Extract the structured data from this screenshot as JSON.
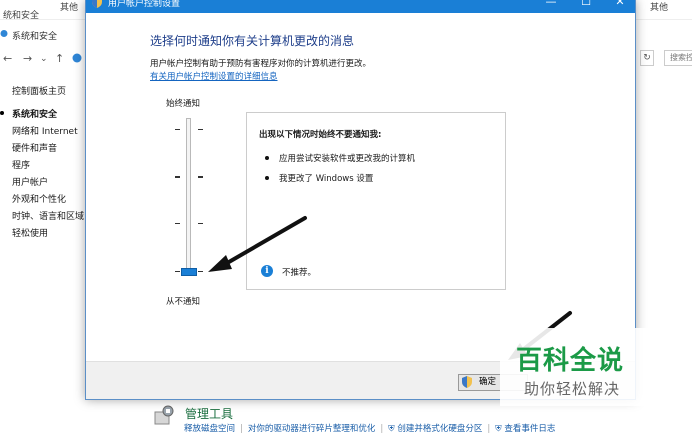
{
  "background": {
    "window_title": "统和安全",
    "tab_left": "其他",
    "tab_right": "其他",
    "address_text": "系统和安全",
    "nav": {
      "back": "←",
      "forward": "→",
      "up": "↑"
    },
    "refresh": "↻",
    "search_placeholder": "搜索控",
    "sidebar": {
      "home": "控制面板主页",
      "items": [
        {
          "label": "系统和安全"
        },
        {
          "label": "网络和 Internet"
        },
        {
          "label": "硬件和声音"
        },
        {
          "label": "程序"
        },
        {
          "label": "用户帐户"
        },
        {
          "label": "外观和个性化"
        },
        {
          "label": "时钟、语言和区域"
        },
        {
          "label": "轻松使用"
        }
      ]
    },
    "admin_tools": {
      "title": "管理工具",
      "links": [
        "释放磁盘空间",
        "对你的驱动器进行碎片整理和优化",
        "创建并格式化硬盘分区",
        "查看事件日志"
      ]
    }
  },
  "dialog": {
    "title": "用户帐户控制设置",
    "window_buttons": {
      "minimize": "—",
      "maximize": "☐",
      "close": "✕"
    },
    "heading": "选择何时通知你有关计算机更改的消息",
    "description": "用户帐户控制有助于预防有害程序对你的计算机进行更改。",
    "link": "有关用户帐户控制设置的详细信息",
    "slider": {
      "top_label": "始终通知",
      "bottom_label": "从不通知",
      "levels": 4,
      "selected_level": 1
    },
    "info": {
      "title": "出现以下情况时始终不要通知我:",
      "items": [
        "应用尝试安装软件或更改我的计算机",
        "我更改了 Windows 设置"
      ],
      "recommendation_icon": "i",
      "recommendation": "不推荐。"
    },
    "ok_button": "确定"
  },
  "watermark": {
    "title": "百科全说",
    "subtitle": "助你轻松解决"
  }
}
